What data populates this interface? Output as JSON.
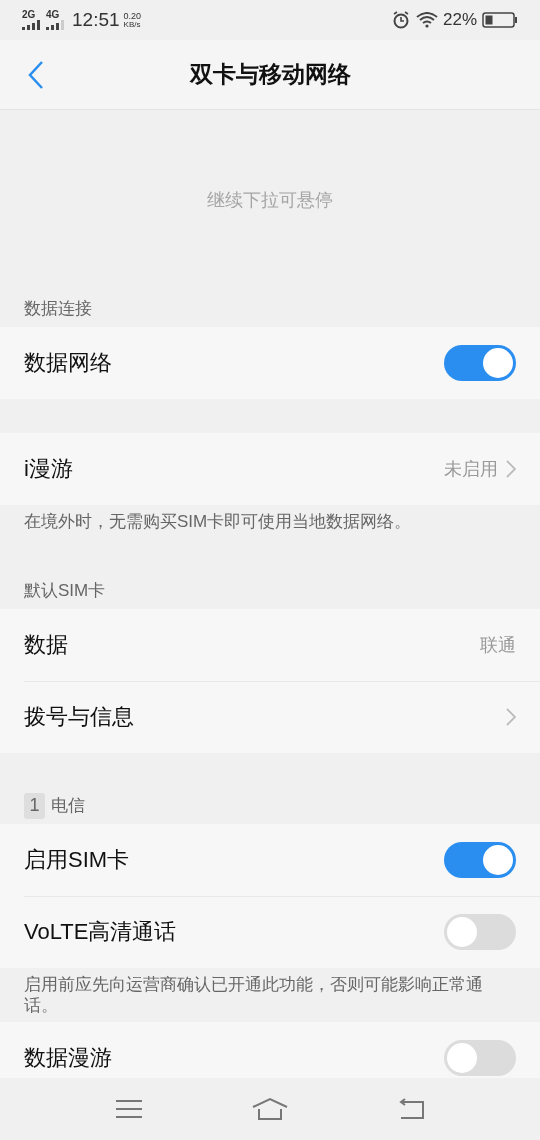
{
  "status_bar": {
    "sim1": "2G",
    "sim2": "4G",
    "time": "12:51",
    "speed": "0.20",
    "speed_unit": "KB/s",
    "battery": "22%"
  },
  "header": {
    "title": "双卡与移动网络"
  },
  "pull_hint": "继续下拉可悬停",
  "groups": [
    {
      "header": {
        "label": "数据连接"
      },
      "rows": [
        {
          "kind": "toggle",
          "label": "数据网络",
          "on": true
        }
      ]
    },
    {
      "rows": [
        {
          "kind": "link",
          "label": "i漫游",
          "value": "未启用"
        }
      ],
      "note": "在境外时，无需购买SIM卡即可使用当地数据网络。"
    },
    {
      "header": {
        "label": "默认SIM卡"
      },
      "rows": [
        {
          "kind": "value",
          "label": "数据",
          "value": "联通"
        },
        {
          "kind": "link",
          "label": "拨号与信息"
        }
      ]
    },
    {
      "header": {
        "badge": "1",
        "label": "电信"
      },
      "rows": [
        {
          "kind": "toggle",
          "label": "启用SIM卡",
          "on": true
        },
        {
          "kind": "toggle",
          "label": "VoLTE高清通话",
          "on": false
        }
      ],
      "note": "启用前应先向运营商确认已开通此功能，否则可能影响正常通话。"
    },
    {
      "rows": [
        {
          "kind": "toggle",
          "label": "数据漫游",
          "on": false
        }
      ]
    }
  ]
}
